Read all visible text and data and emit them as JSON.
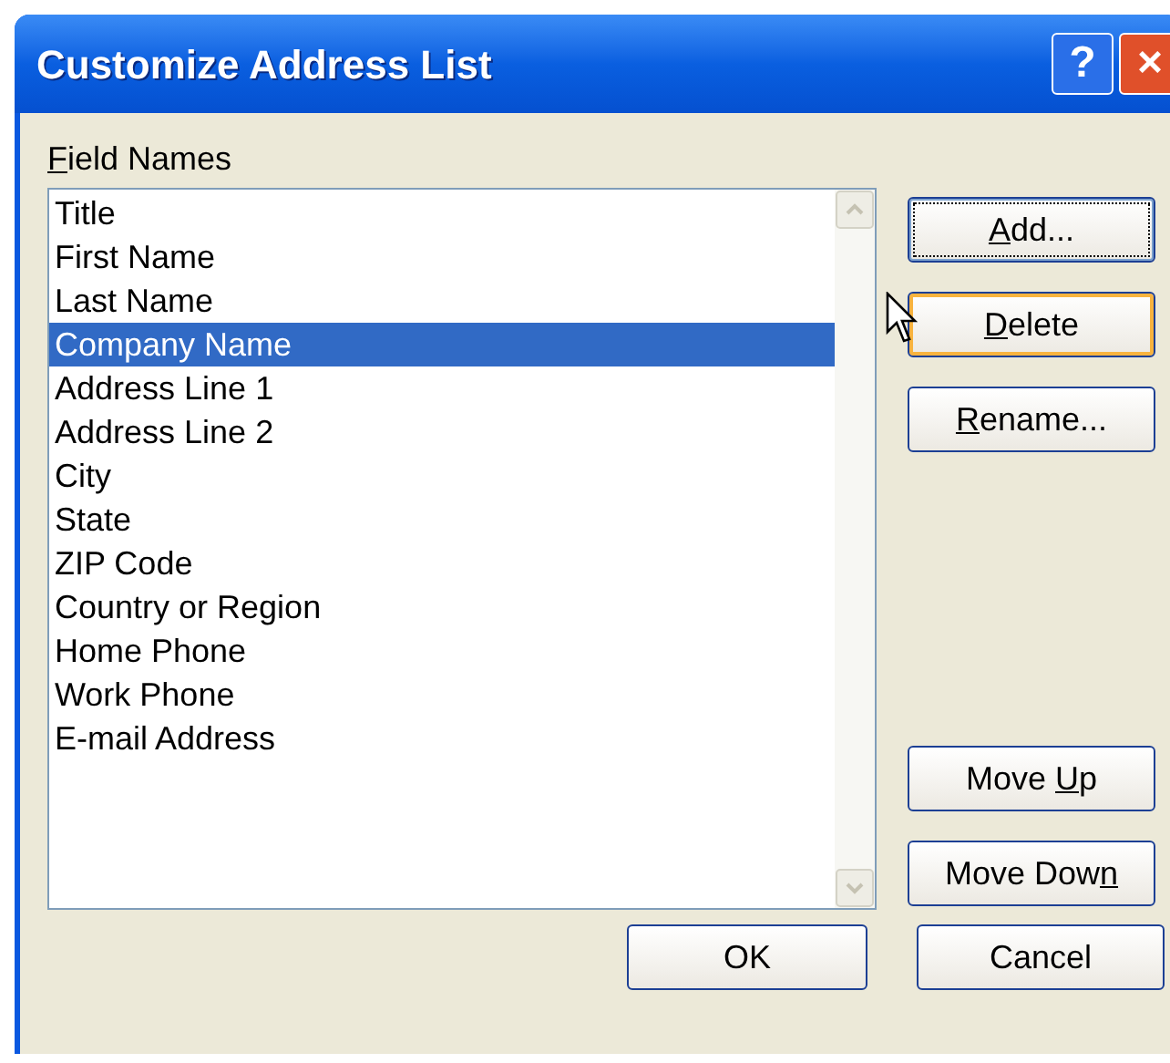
{
  "window": {
    "title": "Customize Address List",
    "title_buttons": [
      {
        "kind": "help",
        "label": "?"
      },
      {
        "kind": "close",
        "label": "×"
      }
    ]
  },
  "field_names": {
    "label": {
      "key": "F",
      "post": "ield Names"
    },
    "items": [
      {
        "label": "Title",
        "selected": false
      },
      {
        "label": "First Name",
        "selected": false
      },
      {
        "label": "Last Name",
        "selected": false
      },
      {
        "label": "Company Name",
        "selected": true
      },
      {
        "label": "Address Line 1",
        "selected": false
      },
      {
        "label": "Address Line 2",
        "selected": false
      },
      {
        "label": "City",
        "selected": false
      },
      {
        "label": "State",
        "selected": false
      },
      {
        "label": "ZIP Code",
        "selected": false
      },
      {
        "label": "Country or Region",
        "selected": false
      },
      {
        "label": "Home Phone",
        "selected": false
      },
      {
        "label": "Work Phone",
        "selected": false
      },
      {
        "label": "E-mail Address",
        "selected": false
      }
    ]
  },
  "top_buttons": [
    {
      "key": "A",
      "post": "dd...",
      "focused": true,
      "hovered": false
    },
    {
      "key": "D",
      "post": "elete",
      "focused": false,
      "hovered": true
    },
    {
      "key": "R",
      "post": "ename...",
      "focused": false,
      "hovered": false
    }
  ],
  "move_buttons": [
    {
      "pre": "Move ",
      "key": "U",
      "post": "p",
      "focused": false,
      "hovered": false
    },
    {
      "pre": "Move Dow",
      "key": "n",
      "focused": false,
      "hovered": false
    }
  ],
  "footer_buttons": [
    {
      "pre": "OK",
      "focused": false,
      "hovered": false
    },
    {
      "pre": "Cancel",
      "focused": false,
      "hovered": false
    }
  ]
}
